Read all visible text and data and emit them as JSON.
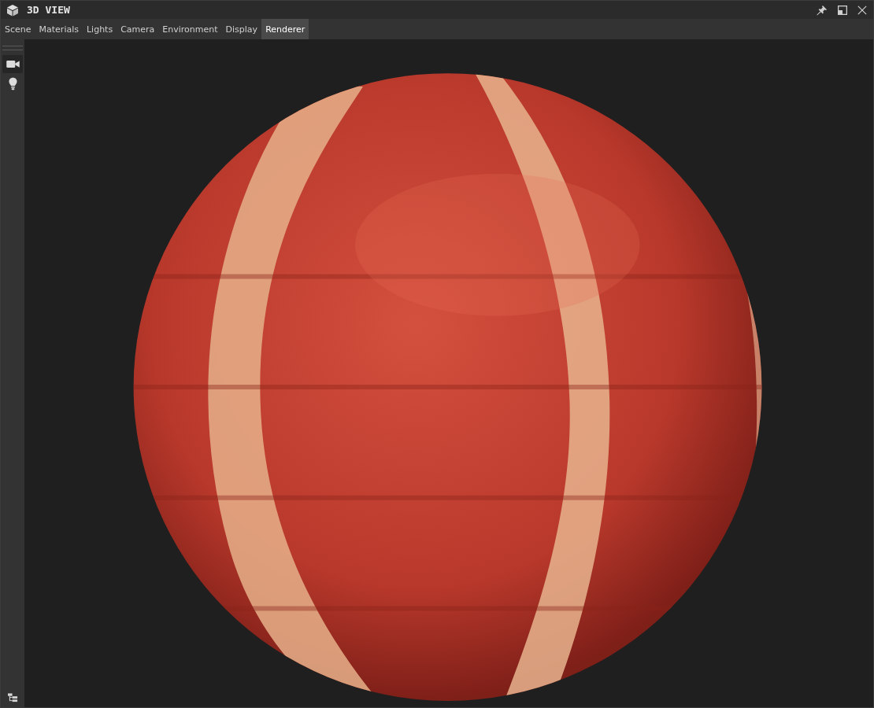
{
  "window": {
    "title": "3D VIEW"
  },
  "tabs": [
    {
      "label": "Scene",
      "selected": false
    },
    {
      "label": "Materials",
      "selected": false
    },
    {
      "label": "Lights",
      "selected": false
    },
    {
      "label": "Camera",
      "selected": false
    },
    {
      "label": "Environment",
      "selected": false
    },
    {
      "label": "Display",
      "selected": false
    },
    {
      "label": "Renderer",
      "selected": true
    }
  ],
  "toolbar": [
    {
      "kind": "camera",
      "selected": true
    },
    {
      "kind": "light",
      "selected": false
    }
  ]
}
